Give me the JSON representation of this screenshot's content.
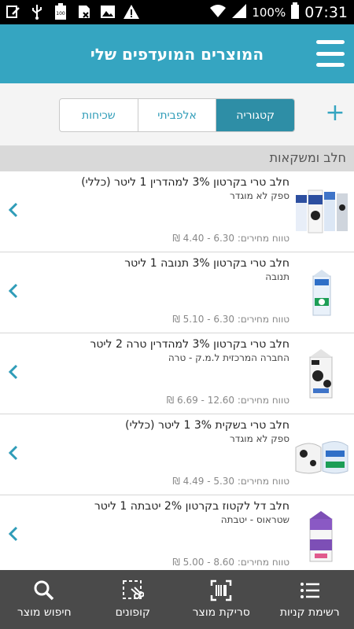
{
  "status_bar": {
    "battery": "100%",
    "time": "07:31",
    "left_icons": [
      "edit-icon",
      "usb-icon",
      "battery-100-icon",
      "no-sim-icon",
      "image-icon",
      "warning-icon"
    ],
    "right_icons": [
      "wifi-icon",
      "signal-icon",
      "battery-icon"
    ]
  },
  "header": {
    "title": "המוצרים המועדפים שלי",
    "menu_icon": "hamburger-icon",
    "color": "#35a5c1"
  },
  "tabs": {
    "add_icon": "plus-icon",
    "items": [
      {
        "label": "קטגוריה",
        "active": true
      },
      {
        "label": "אלפביתי",
        "active": false
      },
      {
        "label": "שכיחות",
        "active": false
      }
    ]
  },
  "section": {
    "title": "חלב ומשקאות"
  },
  "products": [
    {
      "name": "חלב טרי בקרטון 3% למהדרין 1 ליטר (כללי)",
      "supplier": "ספק לא מוגדר",
      "price_range": "טווח מחירים: 6.30 - 4.40 ₪",
      "image": "milk-cartons-group"
    },
    {
      "name": "חלב טרי בקרטון 3% תנובה 1 ליטר",
      "supplier": "תנובה",
      "price_range": "טווח מחירים: 6.30 - 5.10 ₪",
      "image": "tnuva-milk-carton"
    },
    {
      "name": "חלב טרי בקרטון 3% למהדרין טרה 2 ליטר",
      "supplier": "החברה המרכזית ל.מ.ק - טרה",
      "price_range": "טווח מחירים: 12.60 - 6.69 ₪",
      "image": "tara-milk-carton"
    },
    {
      "name": "חלב טרי בשקית 3% 1 ליטר (כללי)",
      "supplier": "ספק לא מוגדר",
      "price_range": "טווח מחירים: 5.30 - 4.49 ₪",
      "image": "milk-bags-group"
    },
    {
      "name": "חלב דל לקטוז בקרטון 2% יטבתה 1 ליטר",
      "supplier": "שטראוס - יטבתה",
      "price_range": "טווח מחירים: 8.60 - 5.00 ₪",
      "image": "yotvata-lactose-free-carton"
    }
  ],
  "bottom_nav": [
    {
      "label": "רשימת קניות",
      "icon": "list-icon"
    },
    {
      "label": "סריקת מוצר",
      "icon": "barcode-scan-icon"
    },
    {
      "label": "קופונים",
      "icon": "coupon-scissors-icon"
    },
    {
      "label": "חיפוש מוצר",
      "icon": "search-icon"
    }
  ]
}
